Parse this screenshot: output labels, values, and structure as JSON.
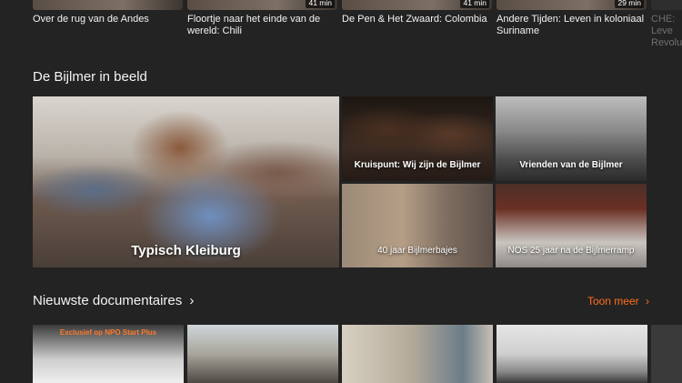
{
  "top_row": {
    "cards": [
      {
        "title": "Over de rug van de Andes",
        "duration": ""
      },
      {
        "title": "Floortje naar het einde van de wereld: Chili",
        "duration": "41 min"
      },
      {
        "title": "De Pen & Het Zwaard: Colombia",
        "duration": "41 min"
      },
      {
        "title": "Andere Tijden: Leven in koloniaal Suriname",
        "duration": "29 min"
      },
      {
        "title": "CHE: Leve Revolut",
        "duration": ""
      }
    ]
  },
  "bijlmer": {
    "title": "De Bijlmer in beeld",
    "tiles": [
      {
        "caption": "Typisch Kleiburg"
      },
      {
        "caption": "Kruispunt: Wij zijn de Bijlmer"
      },
      {
        "caption": "Vrienden van de Bijlmer"
      },
      {
        "caption": "40 jaar Bijlmerbajes"
      },
      {
        "caption": "NOS 25 jaar na de Bijlmerramp"
      }
    ]
  },
  "docs": {
    "title": "Nieuwste documentaires",
    "title_chevron": "›",
    "see_more": "Toon meer",
    "see_more_chevron": "›",
    "first_badge": "Exclusief op NPO Start Plus"
  },
  "colors": {
    "background": "#232323",
    "accent": "#ff6d1f"
  }
}
